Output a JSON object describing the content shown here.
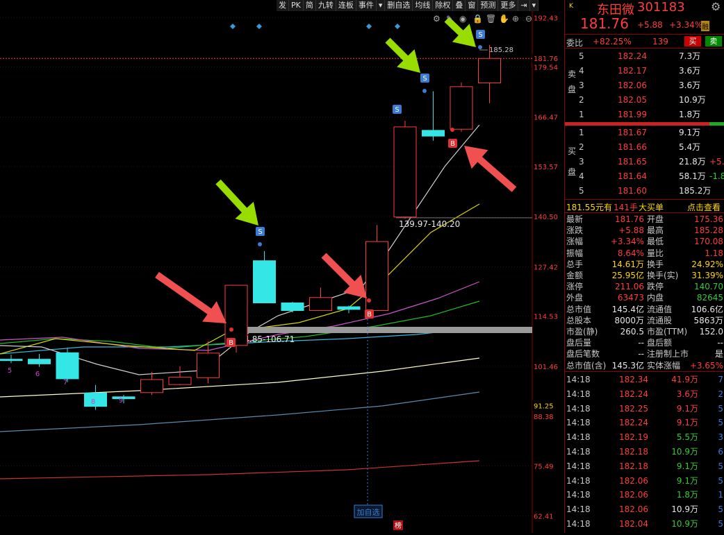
{
  "toolbar": {
    "items": [
      "发",
      "PK",
      "简",
      "九转",
      "连板",
      "事件",
      "▾",
      "删自选",
      "均线",
      "除权",
      "叠",
      "窗",
      "预测",
      "更多",
      "⇥",
      "▾"
    ],
    "icons": [
      "gear-icon",
      "pencil-icon",
      "eye-icon",
      "lock-icon",
      "trash-icon",
      "hand-icon",
      "zoom-in-icon",
      "zoom-out-icon"
    ]
  },
  "price_axis": {
    "labels": [
      "192.43",
      "179.54",
      "166.47",
      "153.57",
      "140.50",
      "127.42",
      "114.53",
      "101.46",
      "88.38",
      "75.49",
      "62.41"
    ],
    "current": "181.76",
    "current_ma": "91.25"
  },
  "chart_labels": {
    "high_label": "185.28",
    "range1": "139.97-140.20",
    "range2": "104.85-106.71",
    "candle_numbers": [
      "5",
      "6",
      "7",
      "8",
      "9"
    ],
    "add_watch": "加自选",
    "bang": "榜"
  },
  "chart_data": {
    "type": "candlestick",
    "candles": [
      {
        "open": 103.3,
        "close": 103.3,
        "high": 104.5,
        "low": 102.3,
        "color": "cyan"
      },
      {
        "open": 103.3,
        "close": 102.1,
        "high": 104.7,
        "low": 101.3,
        "color": "cyan"
      },
      {
        "open": 105.0,
        "close": 98.2,
        "high": 106.2,
        "low": 97.3,
        "color": "cyan"
      },
      {
        "open": 94.5,
        "close": 91.0,
        "high": 96.6,
        "low": 90.1,
        "color": "cyan"
      },
      {
        "open": 93.5,
        "close": 93.0,
        "high": 94.0,
        "low": 91.8,
        "color": "cyan"
      },
      {
        "open": 94.6,
        "close": 98.0,
        "high": 100.0,
        "low": 94.0,
        "color": "red"
      },
      {
        "open": 96.7,
        "close": 98.6,
        "high": 101.5,
        "low": 96.5,
        "color": "red"
      },
      {
        "open": 98.5,
        "close": 104.9,
        "high": 108.0,
        "low": 97.0,
        "color": "red"
      },
      {
        "open": 106.9,
        "close": 122.6,
        "high": 122.6,
        "low": 105.0,
        "color": "red"
      },
      {
        "open": 129.0,
        "close": 118.0,
        "high": 131.5,
        "low": 118.0,
        "color": "cyan"
      },
      {
        "open": 118.0,
        "close": 116.0,
        "high": 118.3,
        "low": 115.5,
        "color": "cyan"
      },
      {
        "open": 119.4,
        "close": 116.0,
        "high": 122.0,
        "low": 115.9,
        "color": "red"
      },
      {
        "open": 117.0,
        "close": 116.3,
        "high": 117.3,
        "low": 115.3,
        "color": "cyan"
      },
      {
        "open": 116.0,
        "close": 134.0,
        "high": 138.3,
        "low": 116.0,
        "color": "red"
      },
      {
        "open": 140.4,
        "close": 163.9,
        "high": 165.5,
        "low": 139.97,
        "color": "red"
      },
      {
        "open": 163.0,
        "close": 161.5,
        "high": 173.2,
        "low": 160.3,
        "color": "cyan"
      },
      {
        "open": 163.3,
        "close": 174.4,
        "high": 175.5,
        "low": 162.6,
        "color": "red"
      },
      {
        "open": 175.36,
        "close": 181.76,
        "high": 185.28,
        "low": 170.08,
        "color": "red"
      }
    ],
    "ylim": [
      58,
      197
    ]
  },
  "quote": {
    "badge": "K",
    "name": "东田微",
    "code": "301183",
    "price": "181.76",
    "change": "+5.88",
    "change_pct": "+3.34%",
    "rong": "融",
    "weibi_label": "委比",
    "weibi": "+82.25%",
    "weicha": "139",
    "buy_btn": "买",
    "sell_btn": "卖",
    "ask_side": "卖盘",
    "bid_side": "买盘"
  },
  "asks": [
    {
      "n": "5",
      "p": "182.24",
      "v": "7.3万",
      "d": ""
    },
    {
      "n": "4",
      "p": "182.17",
      "v": "3.6万",
      "d": ""
    },
    {
      "n": "3",
      "p": "182.06",
      "v": "3.6万",
      "d": ""
    },
    {
      "n": "2",
      "p": "182.05",
      "v": "10.9万",
      "d": ""
    },
    {
      "n": "1",
      "p": "181.99",
      "v": "1.8万",
      "d": ""
    }
  ],
  "bids": [
    {
      "n": "1",
      "p": "181.67",
      "v": "9.1万",
      "d": ""
    },
    {
      "n": "2",
      "p": "181.66",
      "v": "5.4万",
      "d": ""
    },
    {
      "n": "3",
      "p": "181.65",
      "v": "21.8万",
      "d": "+5.4"
    },
    {
      "n": "4",
      "p": "181.64",
      "v": "58.1万",
      "d": "-1.8"
    },
    {
      "n": "5",
      "p": "181.60",
      "v": "185.2万",
      "d": ""
    }
  ],
  "info_bar": {
    "price": "181.55元有",
    "hand": "141手",
    "big": "大买单",
    "link": "点击查看"
  },
  "stats": [
    {
      "l": "最新",
      "v": "181.76",
      "vc": "red",
      "l2": "开盘",
      "v2": "175.36",
      "v2c": "red"
    },
    {
      "l": "涨跌",
      "v": "+5.88",
      "vc": "red",
      "l2": "最高",
      "v2": "185.28",
      "v2c": "red"
    },
    {
      "l": "涨幅",
      "v": "+3.34%",
      "vc": "red",
      "l2": "最低",
      "v2": "170.08",
      "v2c": "red"
    },
    {
      "l": "振幅",
      "v": "8.64%",
      "vc": "red",
      "l2": "量比",
      "v2": "1.18",
      "v2c": "red"
    },
    {
      "l": "总手",
      "v": "14.61万",
      "vc": "yellow",
      "l2": "换手",
      "v2": "24.92%",
      "v2c": "yellow"
    },
    {
      "l": "金额",
      "v": "25.95亿",
      "vc": "yellow",
      "l2": "换手(实)",
      "v2": "31.39%",
      "v2c": "yellow"
    },
    {
      "l": "涨停",
      "v": "211.06",
      "vc": "red",
      "l2": "跌停",
      "v2": "140.70",
      "v2c": "green"
    },
    {
      "l": "外盘",
      "v": "63473",
      "vc": "red",
      "l2": "内盘",
      "v2": "82645",
      "v2c": "green"
    },
    {
      "l": "总市值",
      "v": "145.4亿",
      "vc": "white",
      "l2": "流通值",
      "v2": "106.6亿",
      "v2c": "white"
    },
    {
      "l": "总股本",
      "v": "8000万",
      "vc": "white",
      "l2": "流通股",
      "v2": "5863万",
      "v2c": "white"
    },
    {
      "l": "市盈(静)",
      "v": "260.5",
      "vc": "white",
      "l2": "市盈(TTM)",
      "v2": "152.0",
      "v2c": "white"
    },
    {
      "l": "盘后量",
      "v": "--",
      "vc": "white",
      "l2": "盘后额",
      "v2": "--",
      "v2c": "white"
    },
    {
      "l": "盘后笔数",
      "v": "--",
      "vc": "white",
      "l2": "注册制上市",
      "v2": "是",
      "v2c": "white"
    },
    {
      "l": "总市值(含)",
      "v": "145.3亿",
      "vc": "white",
      "l2": "实体涨幅",
      "v2": "+3.65%",
      "v2c": "red"
    }
  ],
  "ticks": [
    {
      "t": "14:18",
      "p": "182.34",
      "v": "41.9万",
      "n": "7",
      "vc": "red"
    },
    {
      "t": "14:18",
      "p": "182.24",
      "v": "3.6万",
      "n": "2",
      "vc": "red"
    },
    {
      "t": "14:18",
      "p": "182.25",
      "v": "9.1万",
      "n": "5",
      "vc": "red"
    },
    {
      "t": "14:18",
      "p": "182.24",
      "v": "9.1万",
      "n": "5",
      "vc": "red"
    },
    {
      "t": "14:18",
      "p": "182.19",
      "v": "5.5万",
      "n": "3",
      "vc": "green"
    },
    {
      "t": "14:18",
      "p": "182.18",
      "v": "10.9万",
      "n": "6",
      "vc": "green"
    },
    {
      "t": "14:18",
      "p": "182.18",
      "v": "9.1万",
      "n": "5",
      "vc": "green"
    },
    {
      "t": "14:18",
      "p": "182.06",
      "v": "9.1万",
      "n": "5",
      "vc": "green"
    },
    {
      "t": "14:18",
      "p": "182.06",
      "v": "1.8万",
      "n": "1",
      "vc": "green"
    },
    {
      "t": "14:18",
      "p": "182.06",
      "v": "10.9万",
      "n": "5",
      "vc": "white"
    },
    {
      "t": "14:18",
      "p": "182.04",
      "v": "10.9万",
      "n": "5",
      "vc": "green"
    }
  ],
  "colors": {
    "up": "#ff3d3d",
    "down": "#35e6e6",
    "bg": "#000000",
    "grid": "#8b0000",
    "ma_white": "#d0d0d0",
    "ma_yellow": "#d8d800",
    "ma_purple": "#cc55cc",
    "ma_green": "#22bb22",
    "ma_cyan": "#33bbdd",
    "ma_ivory": "#ffffcc",
    "ma_steel": "#5a8ab0",
    "ma_crimson": "#cc3333"
  }
}
